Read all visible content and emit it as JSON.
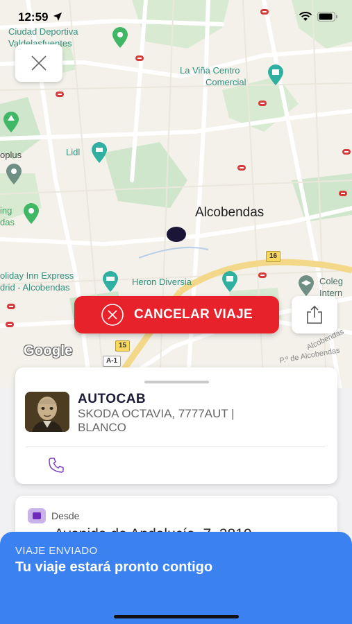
{
  "status_bar": {
    "time": "12:59"
  },
  "map": {
    "places": {
      "ciudad_deportiva_line1": "Ciudad Deportiva",
      "ciudad_deportiva_line2": "Valdelasfuentes",
      "la_vina_line1": "La Viña Centro",
      "la_vina_line2": "Comercial",
      "lidl": "Lidl",
      "plus": "oplus",
      "king_line1": "ing",
      "king_line2": "das",
      "city": "Alcobendas",
      "holiday_line1": "oliday Inn Express",
      "holiday_line2": "drid - Alcobendas",
      "heron": "Heron Diversia",
      "colegio_line1": "Coleg",
      "colegio_line2": "Intern",
      "alcobendas_road_top": "Alcobendas",
      "alcobendas_road_bottom": "P.º de Alcobendas"
    },
    "roads": {
      "r16": "16",
      "r15": "15",
      "a1": "A-1"
    },
    "logo": "Google"
  },
  "actions": {
    "cancel_label": "CANCELAR VIAJE"
  },
  "driver": {
    "name": "AUTOCAB",
    "vehicle": "SKODA OCTAVIA, 7777AUT | BLANCO"
  },
  "route": {
    "from_label": "Desde",
    "from_address": "Avenida de Andalucía, 7, 2810"
  },
  "banner": {
    "eyebrow": "VIAJE ENVIADO",
    "title": "Tu viaje estará pronto contigo"
  },
  "colors": {
    "accent_red": "#e8222b",
    "banner_blue": "#3b82f0",
    "brand_dark": "#1b1638",
    "phone_purple": "#7b3fc4"
  }
}
